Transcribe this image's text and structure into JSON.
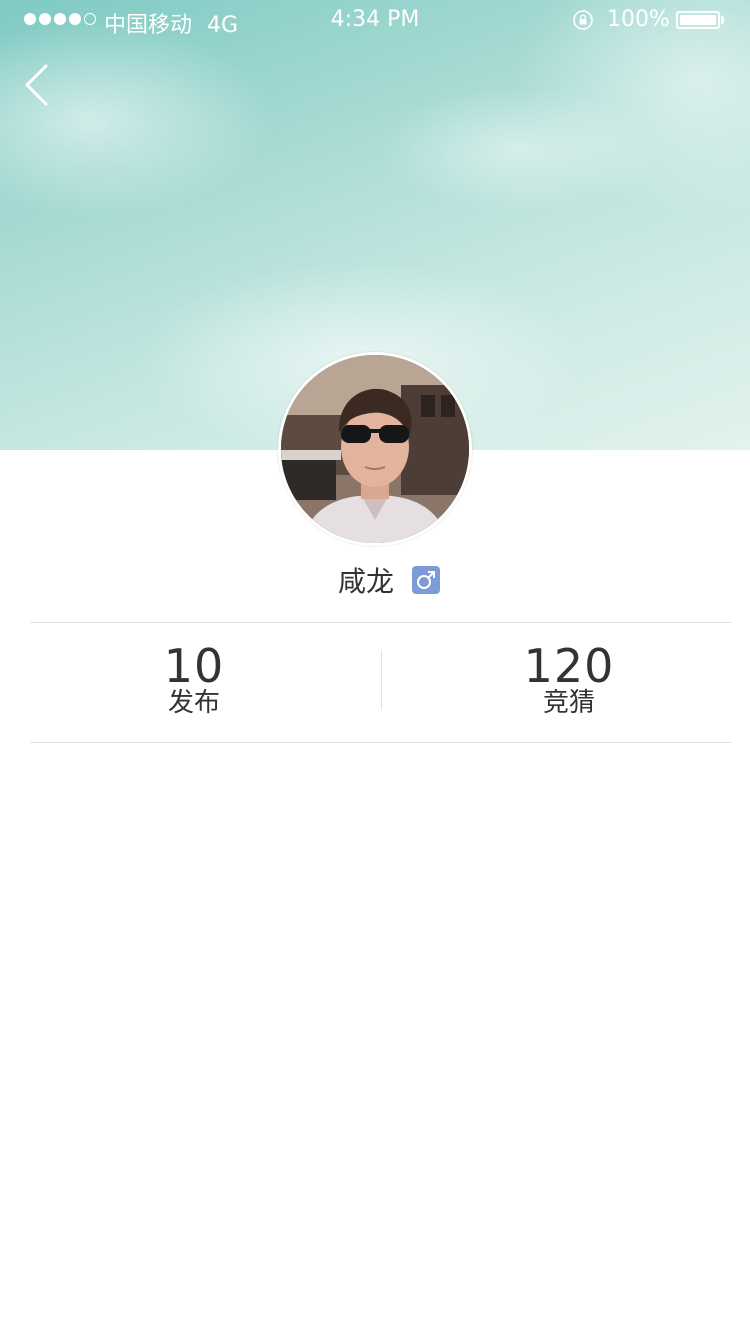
{
  "status_bar": {
    "signal_filled": 4,
    "signal_total": 5,
    "carrier": "中国移动",
    "network": "4G",
    "time": "4:34 PM",
    "battery_percent": "100%",
    "icons": [
      "signal-dots",
      "orientation-lock-icon",
      "battery-icon"
    ]
  },
  "header": {
    "back_icon": "chevron-left-icon",
    "background": "sky-with-clouds"
  },
  "profile": {
    "avatar": "user-photo-man-in-sunglasses",
    "name": "咸龙",
    "gender_symbol": "♂",
    "gender_badge_color": "#7d9bd6"
  },
  "stats": [
    {
      "value": "10",
      "label": "发布"
    },
    {
      "value": "120",
      "label": "竞猜"
    }
  ],
  "colors": {
    "text": "#333333",
    "divider": "#e3e3e3",
    "sky": "#9fd5cf"
  }
}
